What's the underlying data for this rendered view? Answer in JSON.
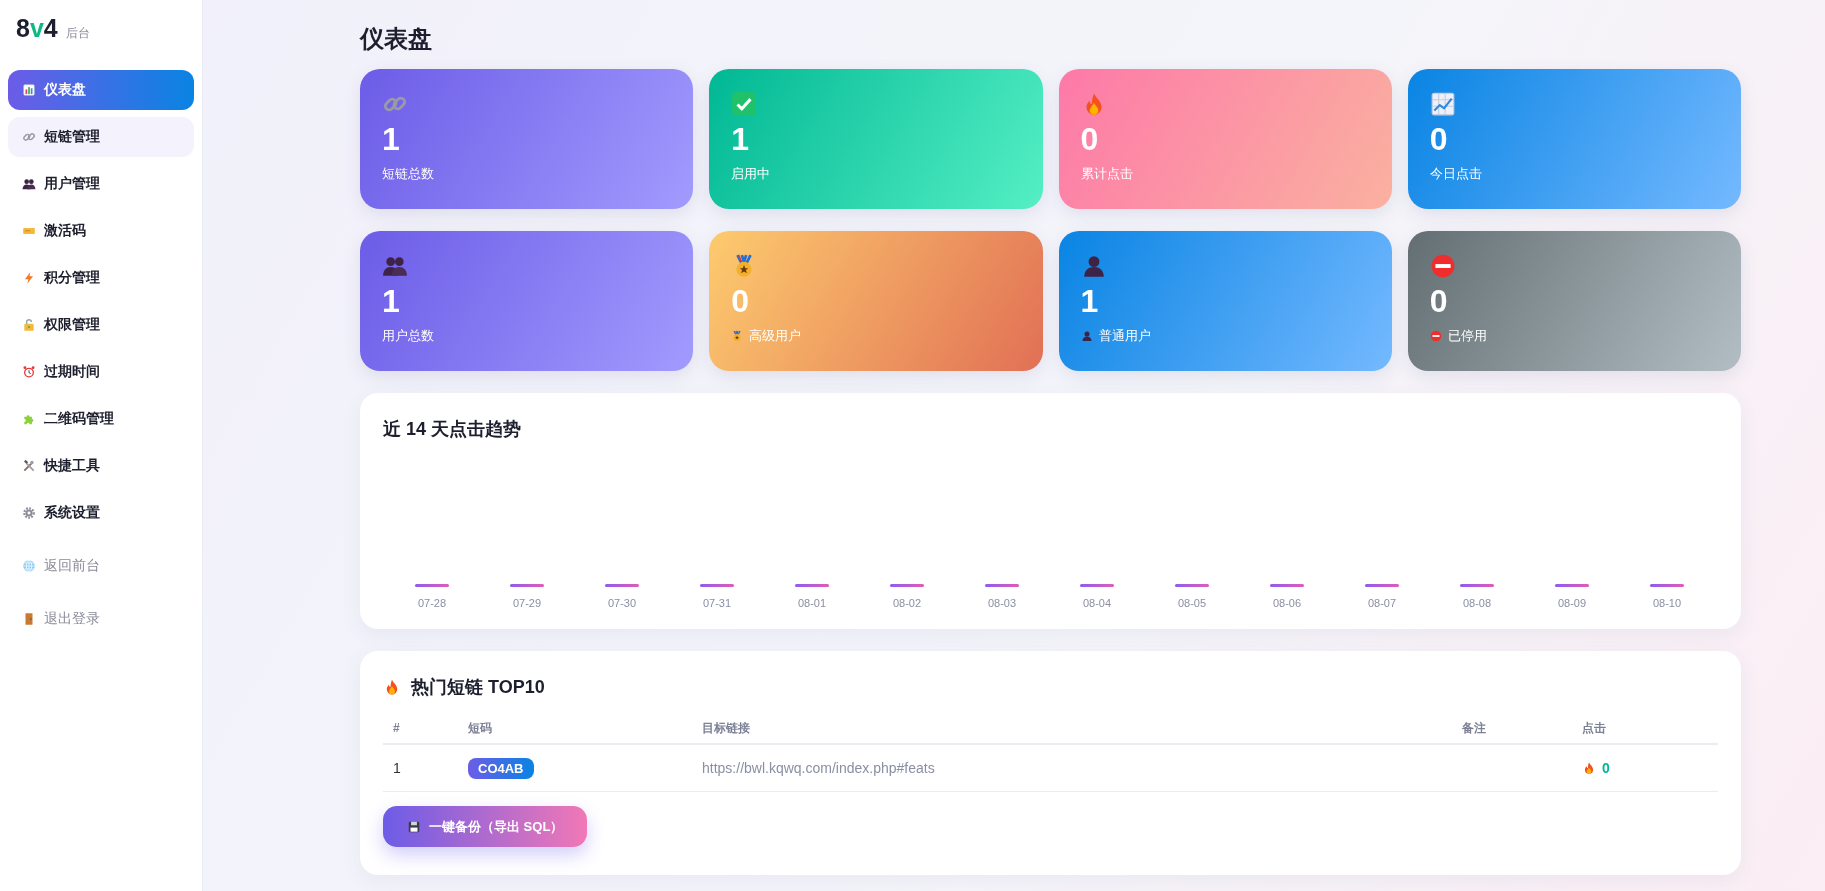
{
  "sidebar": {
    "logo": {
      "prefix": "8",
      "accent": "v",
      "suffix": "4",
      "subtitle": "后台"
    },
    "items": [
      {
        "label": "仪表盘",
        "selected": true,
        "hovered": false
      },
      {
        "label": "短链管理",
        "selected": false,
        "hovered": true
      },
      {
        "label": "用户管理",
        "selected": false,
        "hovered": false
      },
      {
        "label": "激活码",
        "selected": false,
        "hovered": false
      },
      {
        "label": "积分管理",
        "selected": false,
        "hovered": false
      },
      {
        "label": "权限管理",
        "selected": false,
        "hovered": false
      },
      {
        "label": "过期时间",
        "selected": false,
        "hovered": false
      },
      {
        "label": "二维码管理",
        "selected": false,
        "hovered": false
      },
      {
        "label": "快捷工具",
        "selected": false,
        "hovered": false
      },
      {
        "label": "系统设置",
        "selected": false,
        "hovered": false
      }
    ],
    "footer_links": [
      {
        "label": "返回前台"
      },
      {
        "label": "退出登录"
      }
    ]
  },
  "page_title": "仪表盘",
  "stat_cards": [
    {
      "value": "1",
      "label": "短链总数"
    },
    {
      "value": "1",
      "label": "启用中"
    },
    {
      "value": "0",
      "label": "累计点击"
    },
    {
      "value": "0",
      "label": "今日点击"
    },
    {
      "value": "1",
      "label": "用户总数"
    },
    {
      "value": "0",
      "label": "高级用户"
    },
    {
      "value": "1",
      "label": "普通用户"
    },
    {
      "value": "0",
      "label": "已停用"
    }
  ],
  "chart": {
    "title": "近 14 天点击趋势",
    "day_labels": [
      "07-28",
      "07-29",
      "07-30",
      "07-31",
      "08-01",
      "08-02",
      "08-03",
      "08-04",
      "08-05",
      "08-06",
      "08-07",
      "08-08",
      "08-09",
      "08-10"
    ]
  },
  "top_links": {
    "title": "热门短链 TOP10",
    "columns": [
      "#",
      "短码",
      "目标链接",
      "备注",
      "点击"
    ],
    "rows": [
      {
        "rank": "1",
        "code": "CO4AB",
        "url": "https://bwl.kqwq.com/index.php#feats",
        "clicks": "0"
      }
    ]
  },
  "backup_button": "一键备份（导出 SQL）"
}
